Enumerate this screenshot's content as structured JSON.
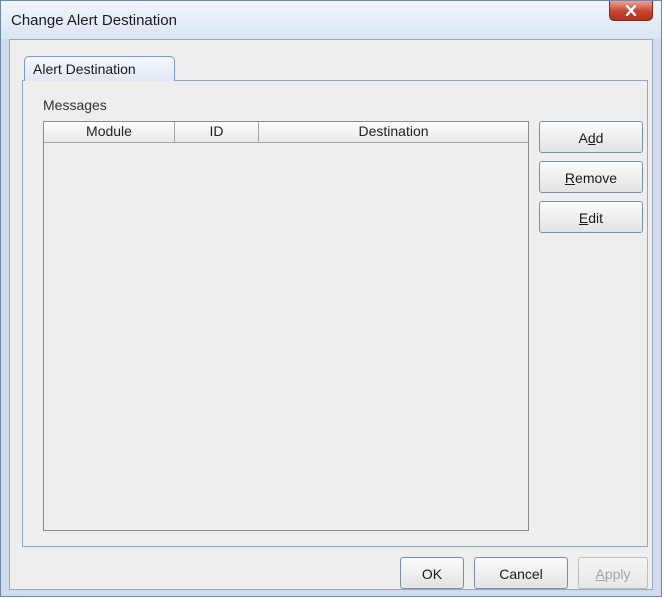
{
  "window": {
    "title": "Change Alert Destination",
    "close_icon": "close-x-icon"
  },
  "tabs": [
    {
      "label": "Alert Destination",
      "selected": true
    }
  ],
  "messages": {
    "label": "Messages",
    "columns": [
      "Module",
      "ID",
      "Destination"
    ],
    "rows": []
  },
  "side_buttons": {
    "add": {
      "pre": "A",
      "mnemonic": "d",
      "post": "d"
    },
    "remove": {
      "pre": "",
      "mnemonic": "R",
      "post": "emove"
    },
    "edit": {
      "pre": "",
      "mnemonic": "E",
      "post": "dit"
    }
  },
  "footer": {
    "ok": "OK",
    "cancel": "Cancel",
    "apply": {
      "pre": "",
      "mnemonic": "A",
      "post": "pply",
      "disabled": true
    }
  }
}
